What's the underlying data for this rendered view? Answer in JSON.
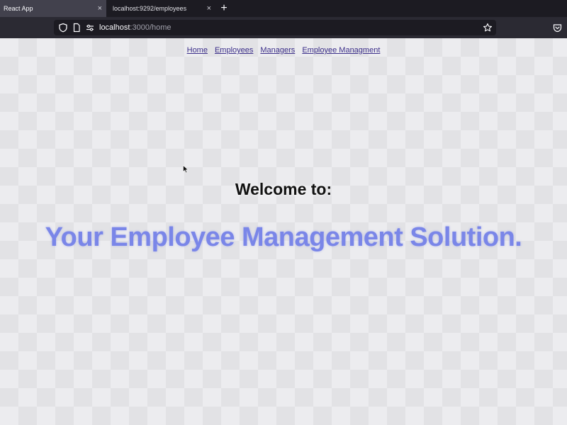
{
  "browser": {
    "tabs": [
      {
        "title": "React App",
        "active": true
      },
      {
        "title": "localhost:9292/employees",
        "active": false
      }
    ],
    "tab_close_glyph": "×",
    "new_tab_glyph": "+",
    "url": {
      "host": "localhost",
      "path": ":3000/home"
    },
    "icons": [
      "shield-icon",
      "page-icon",
      "permissions-icon",
      "bookmark-star-icon",
      "pocket-icon",
      "new-tab-icon",
      "close-icon"
    ]
  },
  "page": {
    "nav": [
      {
        "label": "Home"
      },
      {
        "label": "Employees"
      },
      {
        "label": "Managers"
      },
      {
        "label": "Employee Managment"
      }
    ],
    "welcome": "Welcome to:",
    "tagline": "Your Employee Management Solution.",
    "colors": {
      "tagline": "#7a86e8",
      "nav_link": "#3c2f8a"
    }
  }
}
